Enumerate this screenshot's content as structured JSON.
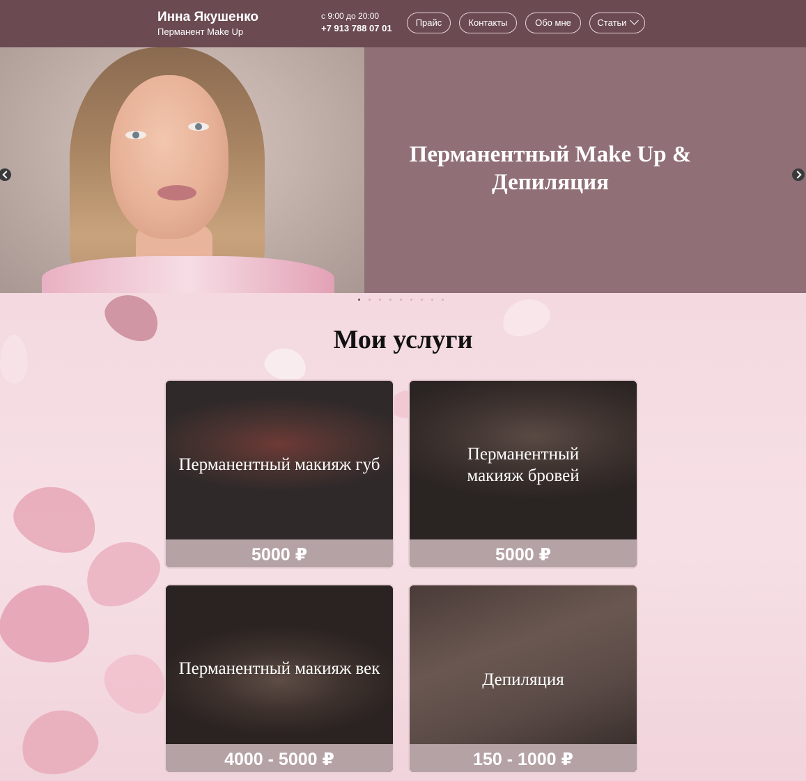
{
  "header": {
    "brand_name": "Инна Якушенко",
    "brand_sub": "Перманент Make Up",
    "hours": "с 9:00 до 20:00",
    "phone": "+7 913 788 07 01",
    "nav": [
      {
        "label": "Прайс"
      },
      {
        "label": "Контакты"
      },
      {
        "label": "Обо мне"
      },
      {
        "label": "Статьи"
      }
    ]
  },
  "hero": {
    "title": "Перманентный Make Up & Депиляция",
    "slide_count": 9,
    "active_slide": 1
  },
  "services": {
    "title": "Мои услуги",
    "cards": [
      {
        "label": "Перманентный макияж губ",
        "price": "5000 ₽"
      },
      {
        "label": "Перманентный макияж бровей",
        "price": "5000 ₽"
      },
      {
        "label": "Перманентный макияж век",
        "price": "4000 - 5000 ₽"
      },
      {
        "label": "Депиляция",
        "price": "150 - 1000 ₽"
      }
    ]
  },
  "colors": {
    "header_bg": "#6b4a52",
    "hero_bg": "#906f76",
    "price_bar": "#b5a2a5",
    "page_bg": "#f3d9df"
  },
  "icons": [
    "prev-arrow-icon",
    "next-arrow-icon",
    "chevron-down-icon"
  ]
}
